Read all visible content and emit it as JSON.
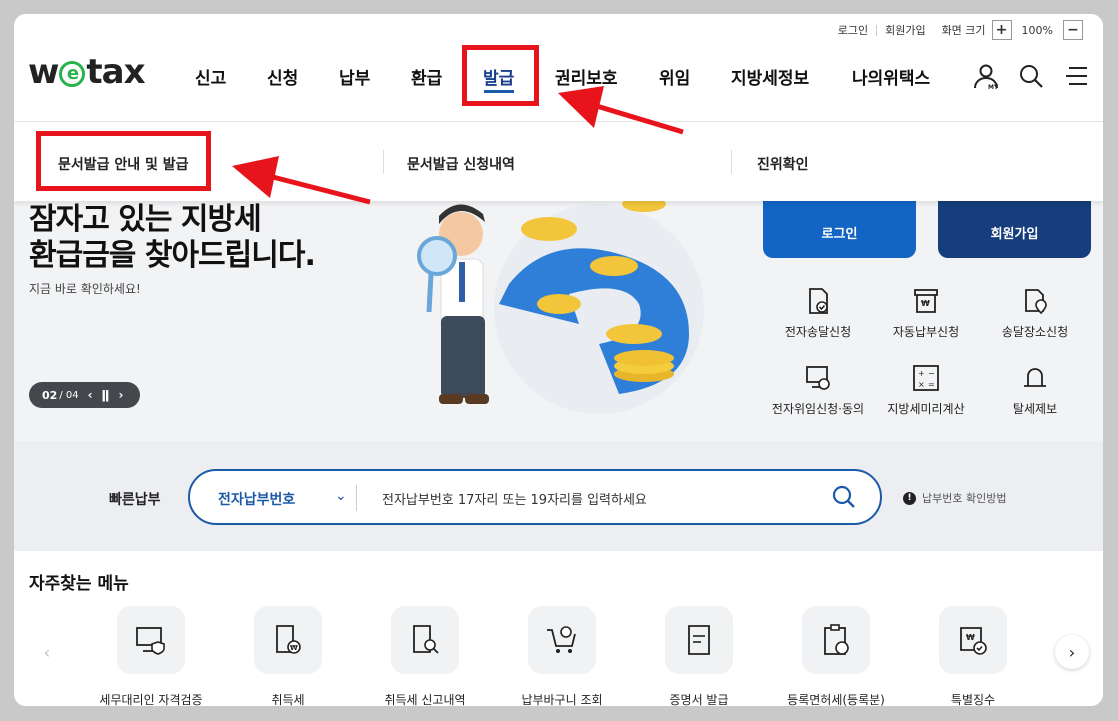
{
  "utility": {
    "login": "로그인",
    "signup": "회원가입",
    "zoom_label": "화면 크기",
    "zoom_in": "+",
    "zoom_value": "100%",
    "zoom_out": "−"
  },
  "logo": {
    "prefix": "w",
    "e": "e",
    "suffix": "tax"
  },
  "nav": {
    "items": [
      "신고",
      "신청",
      "납부",
      "환급",
      "발급",
      "권리보호",
      "위임",
      "지방세정보",
      "나의위택스"
    ],
    "active": "발급"
  },
  "header_icons": [
    "my-page-icon",
    "search-icon",
    "hamburger-menu-icon"
  ],
  "submenu": {
    "items": [
      "문서발급 안내 및 발급",
      "문서발급 신청내역",
      "진위확인"
    ]
  },
  "hero": {
    "title_line1": "잠자고 있는 지방세",
    "title_line2": "환급금을 찾아드립니다.",
    "subtitle": "지금 바로 확인하세요!",
    "pager_current": "02",
    "pager_total": "/ 04"
  },
  "side": {
    "login_button": "로그인",
    "signup_button": "회원가입"
  },
  "quick_menu": [
    "전자송달신청",
    "자동납부신청",
    "송달장소신청",
    "전자위임신청·동의",
    "지방세미리계산",
    "탈세제보"
  ],
  "quick_pay": {
    "label": "빠른납부",
    "select_value": "전자납부번호",
    "placeholder": "전자납부번호 17자리 또는 19자리를 입력하세요",
    "help": "납부번호 확인방법"
  },
  "favorites": {
    "title": "자주찾는 메뉴",
    "items": [
      "세무대리인 자격검증",
      "취득세",
      "취득세 신고내역",
      "납부바구니 조회",
      "증명서 발급",
      "등록면허세(등록분)",
      "특별징수"
    ]
  },
  "colors": {
    "accent_blue": "#1265c4",
    "navy": "#163e7c",
    "annotation_red": "#e8141c"
  }
}
